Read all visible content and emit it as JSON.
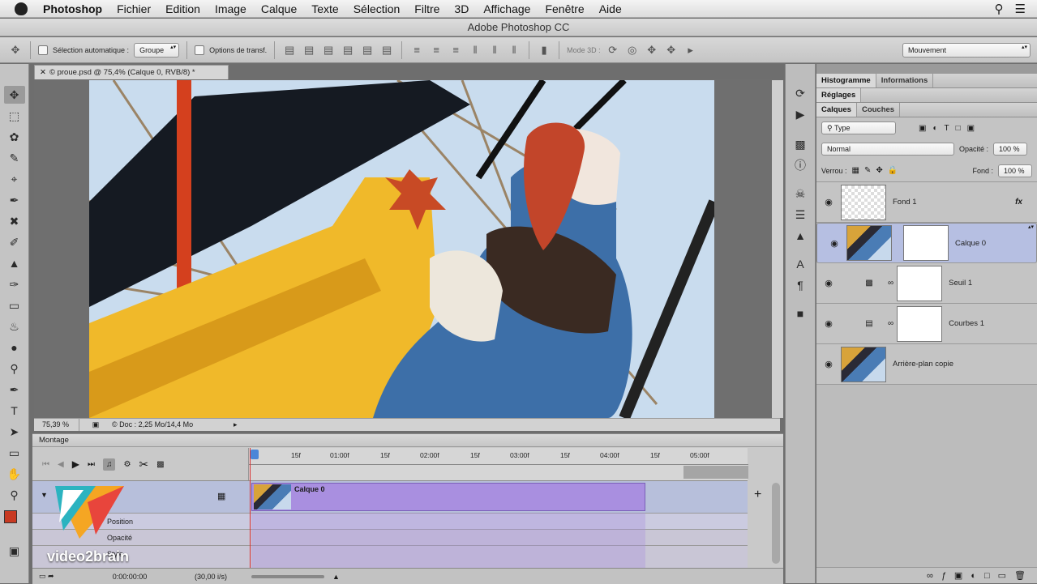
{
  "menubar": {
    "app": "Photoshop",
    "items": [
      "Fichier",
      "Edition",
      "Image",
      "Calque",
      "Texte",
      "Sélection",
      "Filtre",
      "3D",
      "Affichage",
      "Fenêtre",
      "Aide"
    ]
  },
  "window": {
    "title": "Adobe Photoshop CC"
  },
  "options": {
    "auto_select_label": "Sélection automatique :",
    "auto_select_value": "Groupe",
    "transform_label": "Options de transf.",
    "mode3d_label": "Mode 3D :",
    "workspace_value": "Mouvement"
  },
  "document": {
    "tab_title": "© proue.psd @ 75,4% (Calque 0, RVB/8) *",
    "zoom": "75,39 %",
    "doc_info": "© Doc : 2,25 Mo/14,4 Mo"
  },
  "timeline": {
    "title": "Montage",
    "ruler_ticks": [
      "15f",
      "01:00f",
      "15f",
      "02:00f",
      "15f",
      "03:00f",
      "15f",
      "04:00f",
      "15f",
      "05:00f"
    ],
    "clip_name": "Calque 0",
    "props": [
      "Position",
      "Opacité",
      "Style"
    ],
    "timecode": "0:00:00:00",
    "fps": "(30,00 i/s)"
  },
  "panels": {
    "tabs_top": [
      "Histogramme",
      "Informations"
    ],
    "tab_reglages": "Réglages",
    "tabs_layers": [
      "Calques",
      "Couches"
    ],
    "filter_type": "Type",
    "blend_mode": "Normal",
    "opacity_label": "Opacité :",
    "opacity_value": "100 %",
    "lock_label": "Verrou :",
    "fill_label": "Fond :",
    "fill_value": "100 %",
    "fx": "fx",
    "layers": [
      {
        "name": "Fond 1"
      },
      {
        "name": "Calque 0"
      },
      {
        "name": "Seuil 1"
      },
      {
        "name": "Courbes 1"
      },
      {
        "name": "Arrière-plan copie"
      }
    ]
  },
  "watermark": {
    "brand": "video2brain"
  },
  "colors": {
    "accent_selected": "#b6bfe2",
    "clip": "#a98fe0",
    "track": "#b7bfdb"
  }
}
